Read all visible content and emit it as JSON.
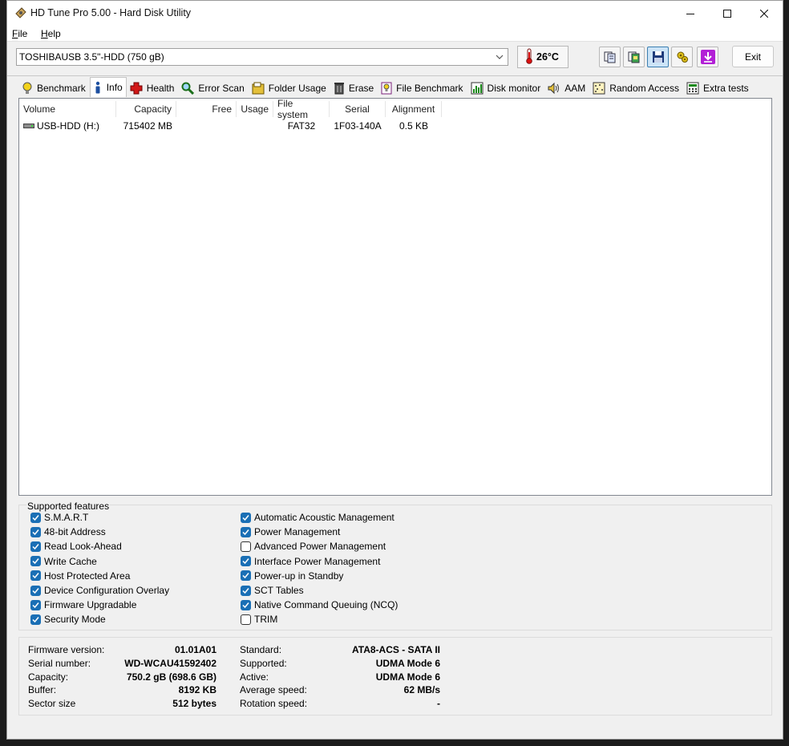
{
  "window": {
    "title": "HD Tune Pro 5.00 - Hard Disk Utility"
  },
  "menu": [
    {
      "label": "File"
    },
    {
      "label": "Help"
    }
  ],
  "toolbar": {
    "drive": "TOSHIBAUSB 3.5\"-HDD (750 gB)",
    "temperature": "26°C",
    "exit_label": "Exit",
    "buttons": [
      "copy-text-icon",
      "copy-screenshot-icon",
      "save-icon",
      "options-icon",
      "download-icon"
    ]
  },
  "tabs": [
    {
      "label": "Benchmark",
      "icon": "bulb-icon"
    },
    {
      "label": "Info",
      "icon": "info-icon",
      "active": true
    },
    {
      "label": "Health",
      "icon": "health-cross-icon"
    },
    {
      "label": "Error Scan",
      "icon": "magnifier-icon"
    },
    {
      "label": "Folder Usage",
      "icon": "folder-icon"
    },
    {
      "label": "Erase",
      "icon": "trash-icon"
    },
    {
      "label": "File Benchmark",
      "icon": "file-benchmark-icon"
    },
    {
      "label": "Disk monitor",
      "icon": "chart-icon"
    },
    {
      "label": "AAM",
      "icon": "speaker-icon"
    },
    {
      "label": "Random Access",
      "icon": "random-access-icon"
    },
    {
      "label": "Extra tests",
      "icon": "calculator-icon"
    }
  ],
  "volumes": {
    "columns": [
      "Volume",
      "Capacity",
      "Free",
      "Usage",
      "File system",
      "Serial",
      "Alignment"
    ],
    "rows": [
      {
        "volume": "USB-HDD (H:)",
        "capacity": "715402 MB",
        "free": "",
        "usage": "",
        "filesystem": "FAT32",
        "serial": "1F03-140A",
        "alignment": "0.5 KB"
      }
    ]
  },
  "features": {
    "title": "Supported features",
    "left": [
      {
        "label": "S.M.A.R.T",
        "checked": true
      },
      {
        "label": "48-bit Address",
        "checked": true
      },
      {
        "label": "Read Look-Ahead",
        "checked": true
      },
      {
        "label": "Write Cache",
        "checked": true
      },
      {
        "label": "Host Protected Area",
        "checked": true
      },
      {
        "label": "Device Configuration Overlay",
        "checked": true
      },
      {
        "label": "Firmware Upgradable",
        "checked": true
      },
      {
        "label": "Security Mode",
        "checked": true
      }
    ],
    "right": [
      {
        "label": "Automatic Acoustic Management",
        "checked": true
      },
      {
        "label": "Power Management",
        "checked": true
      },
      {
        "label": "Advanced Power Management",
        "checked": false
      },
      {
        "label": "Interface Power Management",
        "checked": true
      },
      {
        "label": "Power-up in Standby",
        "checked": true
      },
      {
        "label": "SCT Tables",
        "checked": true
      },
      {
        "label": "Native Command Queuing (NCQ)",
        "checked": true
      },
      {
        "label": "TRIM",
        "checked": false
      }
    ]
  },
  "details": {
    "left": [
      {
        "label": "Firmware version:",
        "value": "01.01A01"
      },
      {
        "label": "Serial number:",
        "value": "WD-WCAU41592402"
      },
      {
        "label": "Capacity:",
        "value": "750.2 gB (698.6 GB)"
      },
      {
        "label": "Buffer:",
        "value": "8192 KB"
      },
      {
        "label": "Sector size",
        "value": "512 bytes"
      }
    ],
    "right": [
      {
        "label": "Standard:",
        "value": "ATA8-ACS - SATA II"
      },
      {
        "label": "Supported:",
        "value": "UDMA Mode 6"
      },
      {
        "label": "Active:",
        "value": "UDMA Mode 6"
      },
      {
        "label": "Average speed:",
        "value": "62 MB/s"
      },
      {
        "label": "Rotation speed:",
        "value": "-"
      }
    ]
  }
}
